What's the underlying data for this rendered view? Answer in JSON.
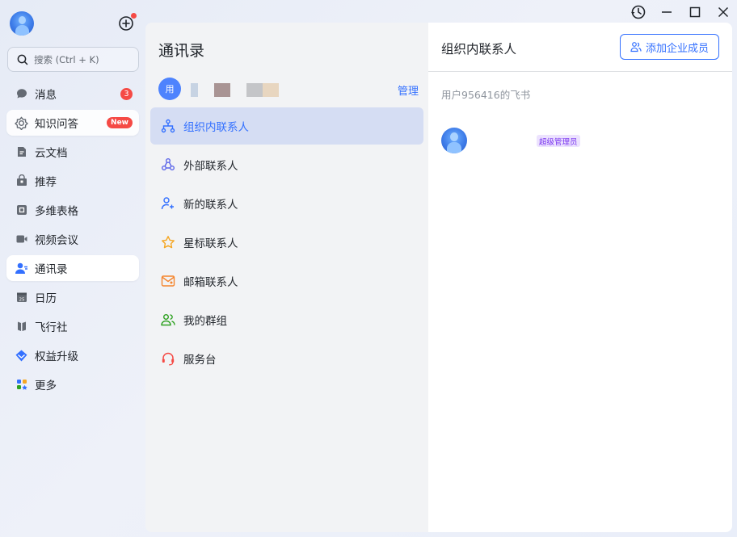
{
  "window_controls": {
    "history": "history-icon",
    "minimize": "minimize-icon",
    "maximize": "maximize-icon",
    "close": "close-icon"
  },
  "sidebar": {
    "search_placeholder": "搜索 (Ctrl + K)",
    "items": [
      {
        "label": "消息",
        "icon": "chat-bubble-icon",
        "badge": "3"
      },
      {
        "label": "知识问答",
        "icon": "knowledge-qa-icon",
        "badge": "New"
      },
      {
        "label": "云文档",
        "icon": "cloud-doc-icon"
      },
      {
        "label": "推荐",
        "icon": "recommend-icon"
      },
      {
        "label": "多维表格",
        "icon": "base-table-icon"
      },
      {
        "label": "视频会议",
        "icon": "video-meeting-icon"
      },
      {
        "label": "通讯录",
        "icon": "contacts-icon",
        "active": true
      },
      {
        "label": "日历",
        "icon": "calendar-icon",
        "calendar_day": "25"
      },
      {
        "label": "飞行社",
        "icon": "feixingshe-icon"
      },
      {
        "label": "权益升级",
        "icon": "upgrade-icon"
      },
      {
        "label": "更多",
        "icon": "more-apps-icon"
      }
    ]
  },
  "middle": {
    "title": "通讯录",
    "org_avatar_text": "用",
    "manage_label": "管理",
    "items": [
      {
        "label": "组织内联系人",
        "icon": "org-tree-icon",
        "active": true
      },
      {
        "label": "外部联系人",
        "icon": "external-contacts-icon"
      },
      {
        "label": "新的联系人",
        "icon": "add-contact-icon"
      },
      {
        "label": "星标联系人",
        "icon": "star-icon"
      },
      {
        "label": "邮箱联系人",
        "icon": "mail-contact-icon"
      },
      {
        "label": "我的群组",
        "icon": "group-icon"
      },
      {
        "label": "服务台",
        "icon": "headset-icon"
      }
    ]
  },
  "right": {
    "title": "组织内联系人",
    "add_member_label": "添加企业成员",
    "tenant_name": "用户956416的飞书",
    "member": {
      "role": "超级管理员"
    }
  },
  "colors": {
    "accent": "#3370ff",
    "badge_red": "#f54a45",
    "active_row": "#d5ddf3",
    "role_badge_bg": "#ece2fe",
    "role_badge_text": "#7a35f0"
  }
}
